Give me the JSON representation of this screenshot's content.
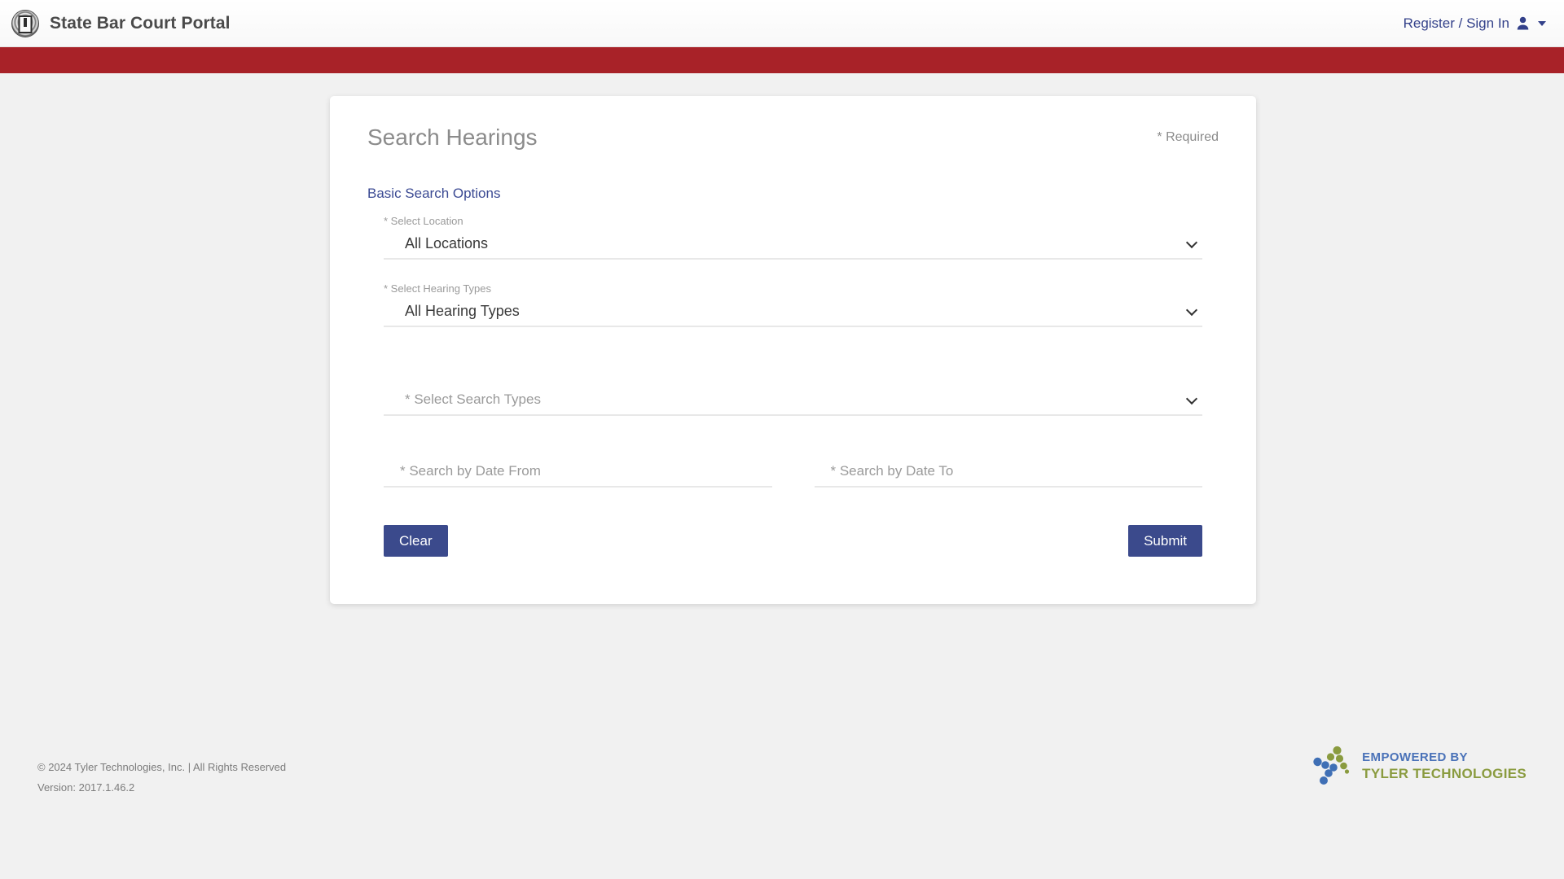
{
  "navbar": {
    "brand_title": "State Bar Court Portal",
    "seal_icon": "court-seal-icon",
    "account_label": "Register / Sign In",
    "user_icon": "user-icon",
    "caret_icon": "caret-down-icon"
  },
  "accent": {
    "red_bar": "#a82228",
    "link_blue": "#3b4a93",
    "button_blue": "#3b4a8c",
    "nav_link_blue": "#33418a"
  },
  "card": {
    "title": "Search Hearings",
    "required_note": "* Required",
    "section_link": "Basic Search Options"
  },
  "form": {
    "location": {
      "label": "* Select Location",
      "value": "All Locations",
      "options": [
        "All Locations"
      ],
      "chevron_icon": "chevron-down-icon"
    },
    "hearing_types": {
      "label": "* Select Hearing Types",
      "value": "All Hearing Types",
      "options": [
        "All Hearing Types"
      ],
      "chevron_icon": "chevron-down-icon"
    },
    "search_types": {
      "label": "",
      "value": "* Select Search Types",
      "options": [
        "* Select Search Types"
      ],
      "chevron_icon": "chevron-down-icon"
    },
    "date_from": {
      "placeholder": "* Search by Date From",
      "value": ""
    },
    "date_to": {
      "placeholder": "* Search by Date To",
      "value": ""
    },
    "clear_button": "Clear",
    "submit_button": "Submit"
  },
  "footer": {
    "copyright": "© 2024 Tyler Technologies, Inc. | All Rights Reserved",
    "version": "Version: 2017.1.46.2",
    "logo_line1": "EMPOWERED BY",
    "logo_line2": "TYLER TECHNOLOGIES",
    "logo_mark_icon": "tyler-dots-icon"
  }
}
